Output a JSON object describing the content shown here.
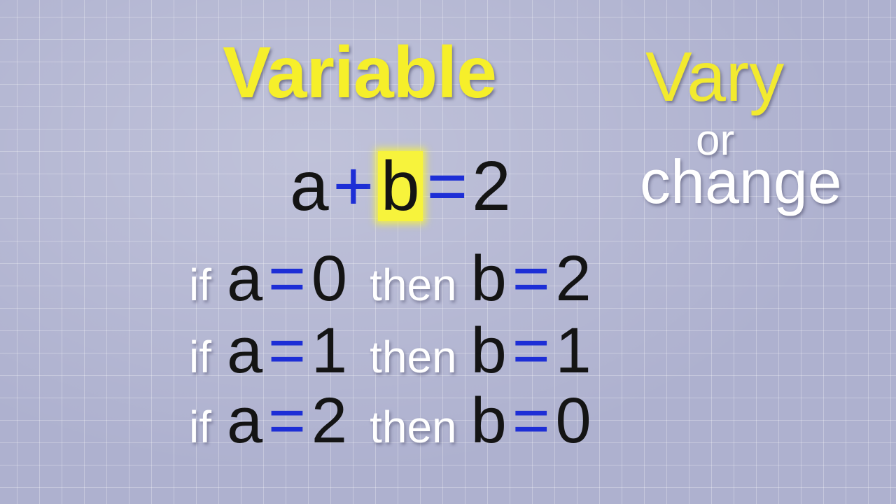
{
  "title": "Variable",
  "side": {
    "word1": "Vary",
    "word2": "or",
    "word3": "change"
  },
  "equation": {
    "var_a": "a",
    "plus": "+",
    "var_b": "b",
    "equals": "=",
    "result": "2",
    "highlighted_variable": "b"
  },
  "rows": [
    {
      "if_word": "if",
      "a": "a",
      "eq1": "=",
      "a_value": "0",
      "then_word": "then",
      "b": "b",
      "eq2": "=",
      "b_value": "2"
    },
    {
      "if_word": "if",
      "a": "a",
      "eq1": "=",
      "a_value": "1",
      "then_word": "then",
      "b": "b",
      "eq2": "=",
      "b_value": "1"
    },
    {
      "if_word": "if",
      "a": "a",
      "eq1": "=",
      "a_value": "2",
      "then_word": "then",
      "b": "b",
      "eq2": "=",
      "b_value": "0"
    }
  ],
  "colors": {
    "title_yellow": "#f6ef2a",
    "operator_blue": "#1d2ed6",
    "highlight_yellow": "#f7f33c",
    "background": "#aeb1cf"
  }
}
